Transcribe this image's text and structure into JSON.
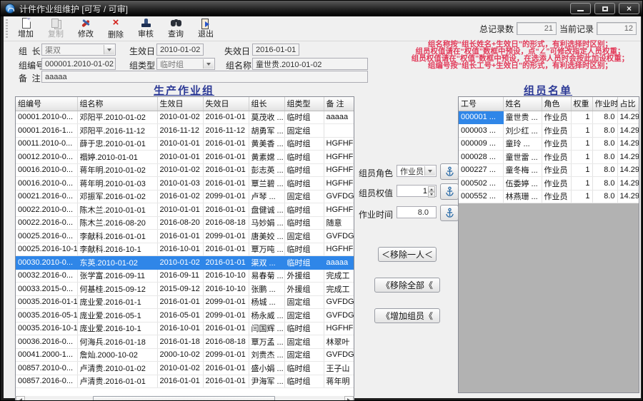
{
  "window": {
    "title": "计件作业组维护  [可写 / 可审]"
  },
  "toolbar": {
    "buttons": [
      {
        "name": "add",
        "label": "增加",
        "icon": "new-doc",
        "disabled": false
      },
      {
        "name": "copy",
        "label": "复制",
        "icon": "copy",
        "disabled": true
      },
      {
        "name": "modify",
        "label": "修改",
        "icon": "tools",
        "disabled": false
      },
      {
        "name": "del",
        "label": "删除",
        "icon": "red-x",
        "disabled": false
      },
      {
        "name": "audit",
        "label": "审核",
        "icon": "stamp",
        "disabled": false
      },
      {
        "name": "query",
        "label": "查询",
        "icon": "binoculars",
        "disabled": false
      },
      {
        "name": "exit",
        "label": "退出",
        "icon": "door",
        "disabled": false
      }
    ],
    "total_records_label": "总记录数",
    "total_records": "21",
    "current_record_label": "当前记录",
    "current_record": "12"
  },
  "form": {
    "leader_label": "组  长",
    "leader_value": "渠双",
    "start_label": "生效日",
    "start_value": "2010-01-02",
    "end_label": "失效日",
    "end_value": "2016-01-01",
    "code_label": "组编号",
    "code_value": "000001.2010-01-02",
    "type_label": "组类型",
    "type_value": "临时组",
    "name_label": "组名称",
    "name_value": "童世贵.2010-01-02",
    "note_label": "备  注",
    "note_value": "aaaaa"
  },
  "notes": {
    "color": "#e23b5a",
    "lines": [
      "组名称按“组长姓名+生效日”的形式，有利选择时区别；",
      "组员权值请在“权值”数框中预设，点“∠”可修改指定人员权重；",
      "组员权值请在“权值”数框中预设，在选添人员时会按此加设权重；",
      "组编号按“组长工号+生效日”的形式，有利选择时区别；"
    ]
  },
  "left_table": {
    "title": "生产作业组",
    "headers": [
      "组编号",
      "组名称",
      "生效日",
      "失效日",
      "组长",
      "组类型",
      "备  注"
    ],
    "selected_row": 11,
    "rows": [
      [
        "00001.2010-0...",
        "邓阳平.2010-01-02",
        "2010-01-02",
        "2016-01-01",
        "莫茂收 ...",
        "临时组",
        "aaaaa"
      ],
      [
        "00001.2016-1...",
        "邓阳平.2016-11-12",
        "2016-11-12",
        "2016-11-12",
        "胡勇军 ...",
        "固定组",
        ""
      ],
      [
        "00011.2010-0...",
        "薛于忠.2010-01-01",
        "2010-01-01",
        "2016-01-01",
        "黄美香 ...",
        "临时组",
        "HGFHFG"
      ],
      [
        "00012.2010-0...",
        "禤婷.2010-01-01",
        "2010-01-01",
        "2016-01-01",
        "黄素嫦 ...",
        "临时组",
        "HGFHFG"
      ],
      [
        "00016.2010-0...",
        "蒋年明.2010-01-02",
        "2010-01-02",
        "2016-01-01",
        "彭志英 ...",
        "临时组",
        "HGFHFG"
      ],
      [
        "00016.2010-0...",
        "蒋年明.2010-01-03",
        "2010-01-03",
        "2016-01-01",
        "覃兰碧 ...",
        "临时组",
        "HGFHFG"
      ],
      [
        "00021.2016-0...",
        "邓振军.2016-01-02",
        "2016-01-02",
        "2099-01-01",
        "卢琴   ...",
        "固定组",
        "GVFDGF"
      ],
      [
        "00022.2010-0...",
        "陈木兰.2010-01-01",
        "2010-01-01",
        "2016-01-01",
        "盘健诚 ...",
        "临时组",
        "HGFHFG"
      ],
      [
        "00022.2016-0...",
        "陈木兰.2016-08-20",
        "2016-08-20",
        "2016-08-18",
        "马妙娟 ...",
        "临时组",
        "随意"
      ],
      [
        "00025.2016-0...",
        "李献科.2016-01-01",
        "2016-01-01",
        "2099-01-01",
        "唐美姣 ...",
        "固定组",
        "GVFDGF"
      ],
      [
        "00025.2016-10-1",
        "李献科.2016-10-1",
        "2016-10-01",
        "2016-01-01",
        "覃万吨 ...",
        "临时组",
        "HGFHFG"
      ],
      [
        "00030.2010-0...",
        "东英.2010-01-02",
        "2010-01-02",
        "2016-01-01",
        "渠双   ...",
        "临时组",
        "aaaaa"
      ],
      [
        "00032.2016-0...",
        "张学富.2016-09-11",
        "2016-09-11",
        "2016-10-10",
        "易春菊 ...",
        "外援组",
        "完成工"
      ],
      [
        "00033.2015-0...",
        "何基桂.2015-09-12",
        "2015-09-12",
        "2016-10-10",
        "张鹏   ...",
        "外援组",
        "完成工"
      ],
      [
        "00035.2016-01-1",
        "庞业爱.2016-01-1",
        "2016-01-01",
        "2099-01-01",
        "杨城   ...",
        "固定组",
        "GVFDGF"
      ],
      [
        "00035.2016-05-1",
        "庞业爱.2016-05-1",
        "2016-05-01",
        "2099-01-01",
        "杨永威 ...",
        "固定组",
        "GVFDGF"
      ],
      [
        "00035.2016-10-1",
        "庞业爱.2016-10-1",
        "2016-10-01",
        "2016-01-01",
        "闫国辉 ...",
        "临时组",
        "HGFHFG"
      ],
      [
        "00036.2016-0...",
        "何海兵.2016-01-18",
        "2016-01-18",
        "2016-08-18",
        "覃万孟 ...",
        "固定组",
        "林翠叶"
      ],
      [
        "00041.2000-1...",
        "詹灿.2000-10-02",
        "2000-10-02",
        "2099-01-01",
        "刘贵杰 ...",
        "固定组",
        "GVFDGF"
      ],
      [
        "00857.2010-0...",
        "卢清贵.2010-01-02",
        "2010-01-02",
        "2016-01-01",
        "盛小娟 ...",
        "临时组",
        "王子山"
      ],
      [
        "00857.2016-0...",
        "卢清贵.2016-01-01",
        "2016-01-01",
        "2016-01-01",
        "尹海军 ...",
        "临时组",
        "蒋年明"
      ]
    ]
  },
  "right_table": {
    "title": "组员名单",
    "headers": [
      "工号",
      "姓名",
      "角色",
      "权重",
      "作业时",
      "占比"
    ],
    "selected_cell": {
      "row": 0,
      "col": 0
    },
    "rows": [
      [
        "000001 ...",
        "童世贵 ...",
        "作业员",
        "1",
        "8.0",
        "14.29"
      ],
      [
        "000003 ...",
        "刘少红 ...",
        "作业员",
        "1",
        "8.0",
        "14.29"
      ],
      [
        "000009 ...",
        "童玲   ...",
        "作业员",
        "1",
        "8.0",
        "14.29"
      ],
      [
        "000028 ...",
        "童世雷 ...",
        "作业员",
        "1",
        "8.0",
        "14.29"
      ],
      [
        "000227 ...",
        "童冬梅 ...",
        "作业员",
        "1",
        "8.0",
        "14.29"
      ],
      [
        "000502 ...",
        "伍委婷 ...",
        "作业员",
        "1",
        "8.0",
        "14.29"
      ],
      [
        "000552 ...",
        "林燕珊 ...",
        "作业员",
        "1",
        "8.0",
        "14.29"
      ]
    ]
  },
  "member_controls": {
    "role_label": "组员角色",
    "role_value": "作业员",
    "weight_label": "组员权值",
    "weight_value": "1",
    "time_label": "作业时间",
    "time_value": "8.0"
  },
  "transfer_buttons": {
    "remove_one": "＜移除一人＜",
    "remove_all": "《移除全部《",
    "add_member": "《增加组员《"
  }
}
